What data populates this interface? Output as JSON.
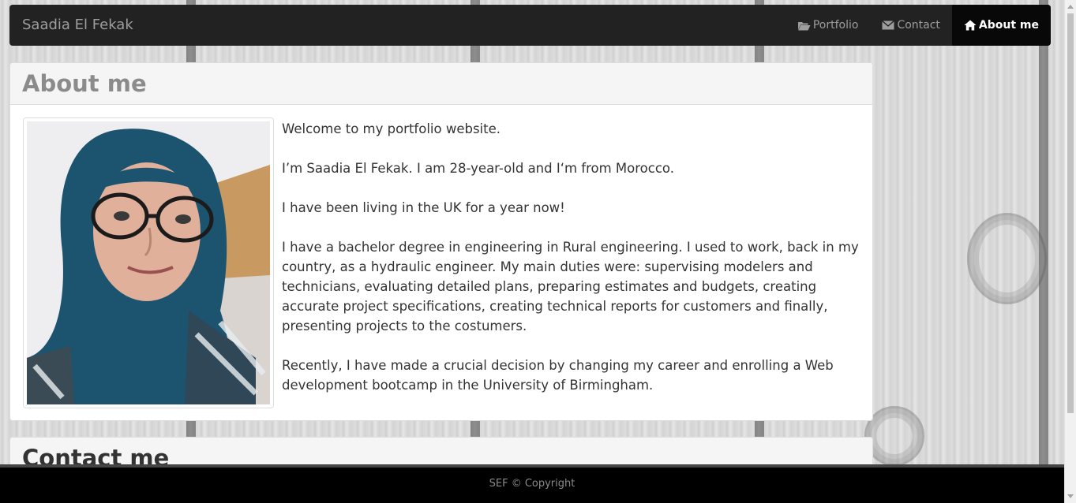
{
  "navbar": {
    "brand": "Saadia El Fekak",
    "items": [
      {
        "label": "Portfolio",
        "icon": "folder-open-icon",
        "active": false
      },
      {
        "label": "Contact",
        "icon": "envelope-icon",
        "active": false
      },
      {
        "label": "About me",
        "icon": "home-icon",
        "active": true
      }
    ]
  },
  "about": {
    "title": "About me",
    "paragraphs": [
      "Welcome to my portfolio website.",
      "I’m Saadia El Fekak. I am 28-year-old and I‘m from Morocco.",
      "I have been living in the UK for a year now!",
      "I have a bachelor degree in engineering in Rural engineering. I used to work, back in my country, as a hydraulic engineer. My main duties were: supervising modelers and technicians, evaluating detailed plans, preparing estimates and budgets, creating accurate project specifications, creating technical reports for customers and finally, presenting projects to the costumers.",
      "Recently, I have made a crucial decision by changing my career and enrolling a Web development bootcamp in the University of Birmingham."
    ]
  },
  "contact": {
    "title": "Contact me"
  },
  "footer": {
    "text": "SEF © Copyright"
  },
  "colors": {
    "navbar_bg": "#222222",
    "navbar_active_bg": "#080808",
    "footer_bg": "#000000"
  }
}
